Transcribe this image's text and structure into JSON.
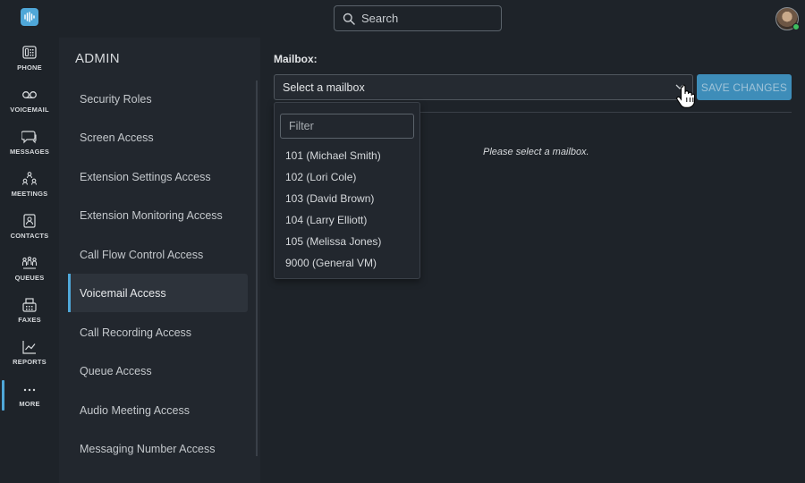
{
  "header": {
    "search_placeholder": "Search"
  },
  "rail": {
    "items": [
      {
        "label": "PHONE",
        "icon": "phone-icon"
      },
      {
        "label": "VOICEMAIL",
        "icon": "voicemail-icon"
      },
      {
        "label": "MESSAGES",
        "icon": "messages-icon"
      },
      {
        "label": "MEETINGS",
        "icon": "meetings-icon"
      },
      {
        "label": "CONTACTS",
        "icon": "contacts-icon"
      },
      {
        "label": "QUEUES",
        "icon": "queues-icon"
      },
      {
        "label": "FAXES",
        "icon": "faxes-icon"
      },
      {
        "label": "REPORTS",
        "icon": "reports-icon"
      },
      {
        "label": "MORE",
        "icon": "more-icon"
      }
    ],
    "active": "MORE"
  },
  "admin": {
    "title": "ADMIN",
    "items": [
      "Security Roles",
      "Screen Access",
      "Extension Settings Access",
      "Extension Monitoring Access",
      "Call Flow Control Access",
      "Voicemail Access",
      "Call Recording Access",
      "Queue Access",
      "Audio Meeting Access",
      "Messaging Number Access"
    ],
    "active": "Voicemail Access"
  },
  "main": {
    "mailbox_label": "Mailbox:",
    "select_value": "Select a mailbox",
    "save_label": "SAVE CHANGES",
    "empty_message": "Please select a mailbox.",
    "dropdown": {
      "filter_placeholder": "Filter",
      "options": [
        "101 (Michael Smith)",
        "102 (Lori Cole)",
        "103 (David Brown)",
        "104 (Larry Elliott)",
        "105 (Melissa Jones)",
        "9000 (General VM)"
      ]
    }
  },
  "colors": {
    "accent": "#4fa7d8",
    "save_button": "#3e8db9",
    "background": "#1e2329",
    "panel": "#22272e"
  }
}
